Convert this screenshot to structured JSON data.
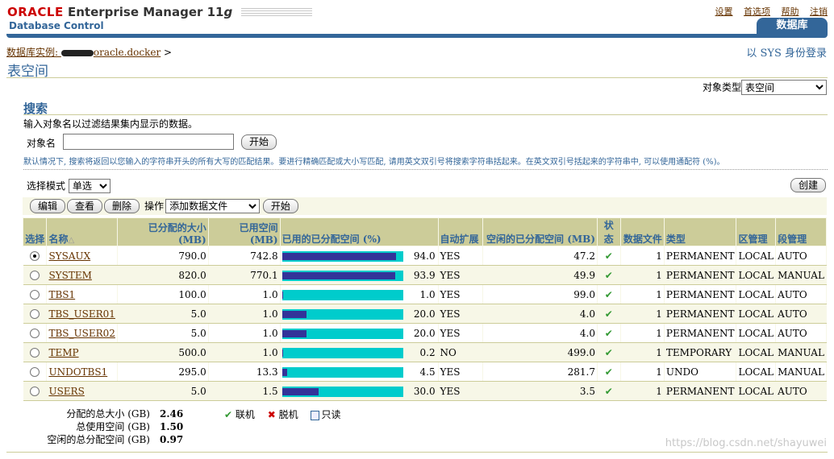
{
  "header": {
    "brand_oracle": "ORACLE",
    "brand_product": "Enterprise Manager 11",
    "brand_version": "g",
    "subtitle": "Database Control",
    "links": [
      "设置",
      "首选项",
      "帮助",
      "注销"
    ],
    "tab_label": "数据库"
  },
  "breadcrumb": {
    "prefix": "数据库实例: ",
    "instance": "oracle.docker",
    "sep": ">"
  },
  "login_text": "以 SYS 身份登录",
  "page_title": "表空间",
  "object_type": {
    "label": "对象类型",
    "value": "表空间"
  },
  "search": {
    "title": "搜索",
    "description": "输入对象名以过滤结果集内显示的数据。",
    "object_label": "对象名",
    "object_value": "",
    "go_label": "开始",
    "hint": "默认情况下, 搜索将返回以您输入的字符串开头的所有大写的匹配结果。要进行精确匹配或大小写匹配, 请用英文双引号将搜索字符串括起来。在英文双引号括起来的字符串中, 可以使用通配符 (%)。"
  },
  "selection_mode": {
    "label": "选择模式",
    "value": "单选"
  },
  "create_label": "创建",
  "toolbar": {
    "edit": "编辑",
    "view": "查看",
    "delete": "删除",
    "op_label": "操作",
    "op_value": "添加数据文件",
    "go": "开始"
  },
  "table": {
    "headers": {
      "select": "选择",
      "name": "名称",
      "alloc_size": "已分配的大小 (MB)",
      "used_space": "已用空间 (MB)",
      "used_pct": "已用的已分配空间 (%)",
      "autoextend": "自动扩展",
      "free_space": "空闲的已分配空间 (MB)",
      "status": "状态",
      "datafiles": "数据文件",
      "type": "类型",
      "extent_mgmt": "区管理",
      "segment_mgmt": "段管理"
    },
    "rows": [
      {
        "name": "SYSAUX",
        "alloc": "790.0",
        "used": "742.8",
        "pct": 94.0,
        "pct_text": "94.0",
        "auto": "YES",
        "free": "47.2",
        "files": "1",
        "type": "PERMANENT",
        "extent": "LOCAL",
        "segment": "AUTO"
      },
      {
        "name": "SYSTEM",
        "alloc": "820.0",
        "used": "770.1",
        "pct": 93.9,
        "pct_text": "93.9",
        "auto": "YES",
        "free": "49.9",
        "files": "1",
        "type": "PERMANENT",
        "extent": "LOCAL",
        "segment": "MANUAL"
      },
      {
        "name": "TBS1",
        "alloc": "100.0",
        "used": "1.0",
        "pct": 1.0,
        "pct_text": "1.0",
        "auto": "YES",
        "free": "99.0",
        "files": "1",
        "type": "PERMANENT",
        "extent": "LOCAL",
        "segment": "AUTO"
      },
      {
        "name": "TBS_USER01",
        "alloc": "5.0",
        "used": "1.0",
        "pct": 20.0,
        "pct_text": "20.0",
        "auto": "YES",
        "free": "4.0",
        "files": "1",
        "type": "PERMANENT",
        "extent": "LOCAL",
        "segment": "AUTO"
      },
      {
        "name": "TBS_USER02",
        "alloc": "5.0",
        "used": "1.0",
        "pct": 20.0,
        "pct_text": "20.0",
        "auto": "YES",
        "free": "4.0",
        "files": "1",
        "type": "PERMANENT",
        "extent": "LOCAL",
        "segment": "AUTO"
      },
      {
        "name": "TEMP",
        "alloc": "500.0",
        "used": "1.0",
        "pct": 0.2,
        "pct_text": "0.2",
        "auto": "NO",
        "free": "499.0",
        "files": "1",
        "type": "TEMPORARY",
        "extent": "LOCAL",
        "segment": "MANUAL"
      },
      {
        "name": "UNDOTBS1",
        "alloc": "295.0",
        "used": "13.3",
        "pct": 4.5,
        "pct_text": "4.5",
        "auto": "YES",
        "free": "281.7",
        "files": "1",
        "type": "UNDO",
        "extent": "LOCAL",
        "segment": "MANUAL"
      },
      {
        "name": "USERS",
        "alloc": "5.0",
        "used": "1.5",
        "pct": 30.0,
        "pct_text": "30.0",
        "auto": "YES",
        "free": "3.5",
        "files": "1",
        "type": "PERMANENT",
        "extent": "LOCAL",
        "segment": "AUTO"
      }
    ]
  },
  "totals": [
    {
      "label": "分配的总大小 (GB)",
      "value": "2.46"
    },
    {
      "label": "总使用空间 (GB)",
      "value": "1.50"
    },
    {
      "label": "空闲的总分配空间 (GB)",
      "value": "0.97"
    }
  ],
  "legend": {
    "online": "联机",
    "offline": "脱机",
    "readonly": "只读"
  },
  "watermark": "https://blog.csdn.net/shayuwei",
  "colors": {
    "accent": "#336699",
    "header_bg": "#cccc99",
    "bar_used": "#333399",
    "bar_free": "#00cccc",
    "link": "#663300"
  }
}
